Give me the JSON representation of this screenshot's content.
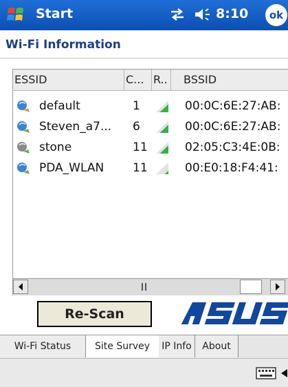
{
  "taskbar": {
    "start_label": "Start",
    "time": "8:10",
    "ok_label": "ok"
  },
  "app": {
    "title": "Wi-Fi Information"
  },
  "table": {
    "columns": [
      "ESSID",
      "C...",
      "R..",
      "BSSID"
    ],
    "rows": [
      {
        "essid": "default",
        "channel": "1",
        "signal": 0.7,
        "bssid": "00:0C:6E:27:AB:"
      },
      {
        "essid": "Steven_a7...",
        "channel": "6",
        "signal": 0.7,
        "bssid": "00:0C:6E:27:AB:"
      },
      {
        "essid": "stone",
        "channel": "11",
        "signal": 0.7,
        "bssid": "02:05:C3:4E:0B:"
      },
      {
        "essid": "PDA_WLAN",
        "channel": "11",
        "signal": 0.3,
        "bssid": "00:E0:18:F4:41:"
      }
    ]
  },
  "rescan_label": "Re-Scan",
  "logo_text": "ASUS",
  "tabs": [
    "Wi-Fi Status",
    "Site Survey",
    "IP Info",
    "About"
  ],
  "active_tab": "Site Survey",
  "colors": {
    "title_blue": "#0b4fb3",
    "heading_blue": "#1c3f88",
    "signal_green": "#33b24a",
    "asus_blue": "#12479e"
  }
}
